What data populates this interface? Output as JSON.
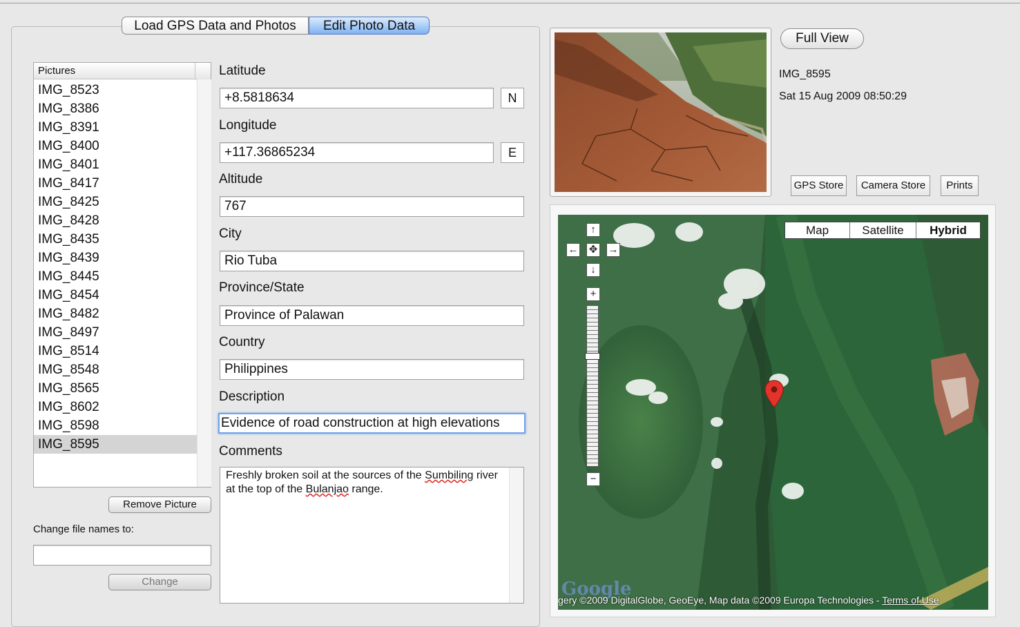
{
  "tabs": [
    {
      "label": "Load GPS Data and Photos",
      "active": false
    },
    {
      "label": "Edit Photo Data",
      "active": true
    }
  ],
  "pictures": {
    "header": "Pictures",
    "items": [
      "IMG_8523",
      "IMG_8386",
      "IMG_8391",
      "IMG_8400",
      "IMG_8401",
      "IMG_8417",
      "IMG_8425",
      "IMG_8428",
      "IMG_8435",
      "IMG_8439",
      "IMG_8445",
      "IMG_8454",
      "IMG_8482",
      "IMG_8497",
      "IMG_8514",
      "IMG_8548",
      "IMG_8565",
      "IMG_8602",
      "IMG_8598",
      "IMG_8595"
    ],
    "selected": "IMG_8595"
  },
  "remove_picture_label": "Remove Picture",
  "rename": {
    "label": "Change file names to:",
    "value": "",
    "button": "Change"
  },
  "fields": {
    "latitude": {
      "label": "Latitude",
      "value": "+8.5818634",
      "hemisphere": "N"
    },
    "longitude": {
      "label": "Longitude",
      "value": "+117.36865234",
      "hemisphere": "E"
    },
    "altitude": {
      "label": "Altitude",
      "value": "767"
    },
    "city": {
      "label": "City",
      "value": "Rio Tuba"
    },
    "province": {
      "label": "Province/State",
      "value": "Province of Palawan"
    },
    "country": {
      "label": "Country",
      "value": "Philippines"
    },
    "description": {
      "label": "Description",
      "value": "Evidence of road construction at high elevations"
    },
    "comments": {
      "label": "Comments",
      "value_parts": [
        "Freshly broken soil at the sources of the ",
        "Sumbiling",
        " river at the top of the ",
        "Bulanjao",
        " range."
      ]
    }
  },
  "photo": {
    "full_view_label": "Full View",
    "name": "IMG_8595",
    "datetime": "Sat 15 Aug 2009 08:50:29"
  },
  "store_buttons": [
    "GPS Store",
    "Camera Store",
    "Prints"
  ],
  "map": {
    "types": [
      "Map",
      "Satellite",
      "Hybrid"
    ],
    "active_type": "Hybrid",
    "logo": "Google",
    "copyright_prefix": "gery ©2009 DigitalGlobe, GeoEye, Map data ©2009 Europa Technologies - ",
    "terms": "Terms of Use",
    "zoom_level_fraction": 0.31
  },
  "colors": {
    "tab_active": "#7fb3f2",
    "focus_ring": "#6fa3e8",
    "marker": "#e2342a"
  }
}
